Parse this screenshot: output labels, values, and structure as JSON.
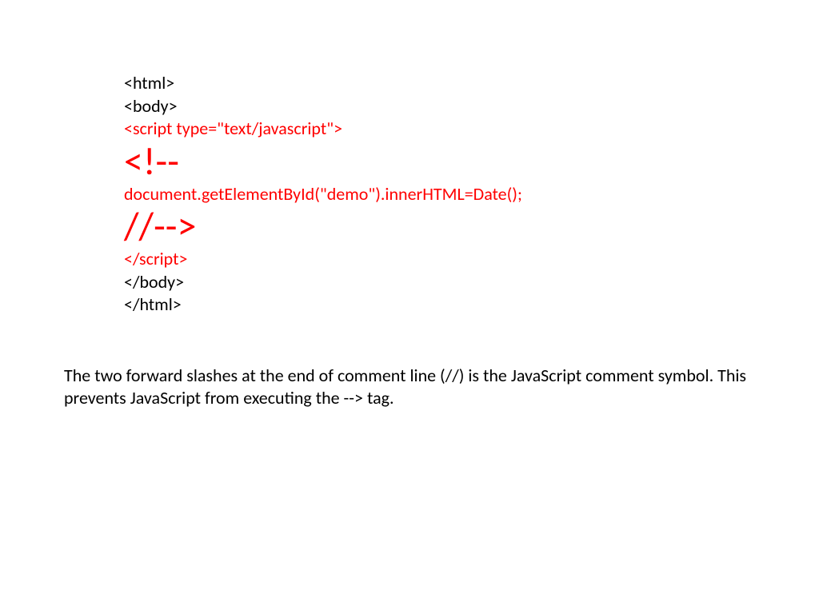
{
  "code": {
    "line1": "<html>",
    "line2": "<body>",
    "line3": "<script type=\"text/javascript\">",
    "line4": "<!--",
    "line5": "document.getElementById(\"demo\").innerHTML=Date();",
    "line6": "//-->",
    "line7": "</script>",
    "line8": "</body>",
    "line9": "</html>"
  },
  "explanation": "The two forward slashes at the end of comment line (//) is the JavaScript comment symbol. This prevents JavaScript from executing the --> tag."
}
